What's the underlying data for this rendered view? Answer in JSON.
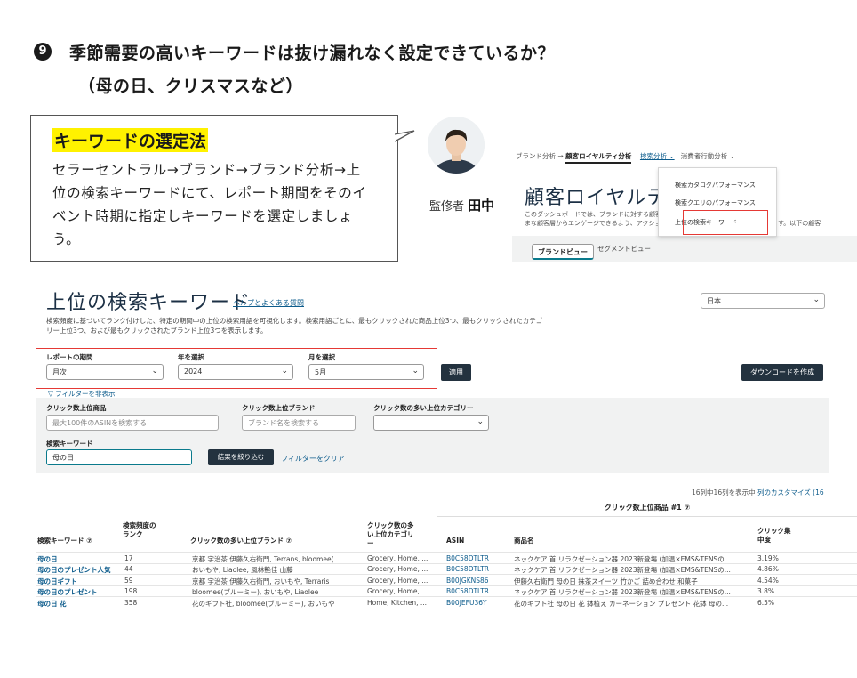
{
  "heading": {
    "number": "9",
    "line1": "季節需要の高いキーワードは抜け漏れなく設定できているか？",
    "line2": "（母の日、クリスマスなど）"
  },
  "callout": {
    "title": "キーワードの選定法",
    "body": "セラーセントラル→ブランド→ブランド分析→上位の検索キーワードにて、レポート期間をそのイベント時期に指定しキーワードを選定しましょう。"
  },
  "supervisor": {
    "prefix": "監修者",
    "name": "田中"
  },
  "mini": {
    "crumb_1": "ブランド分析",
    "crumb_arrow": "→",
    "crumb_2": "顧客ロイヤルティ分析",
    "crumb_3": "検索分析 ⌄",
    "crumb_4": "消費者行動分析 ⌄",
    "menu": [
      "検索カタログパフォーマンス",
      "検索クエリのパフォーマンス",
      "上位の検索キーワード"
    ],
    "title": "顧客ロイヤルティ",
    "desc": "このダッシュボードでは、ブランドに対する顧客のロイヤルティを理解し、さまざまな顧客層からエンゲージできるよう、アクションを",
    "desc_right": "ます。以下の顧客",
    "tabs": [
      "ブランドビュー",
      "セグメントビュー"
    ]
  },
  "report": {
    "title": "上位の検索キーワード",
    "help_link": "ヘルプとよくある質問",
    "desc": "検索頻度に基づいてランク付けした、特定の期間中の上位の検索用語を可視化します。検索用語ごとに、最もクリックされた商品上位3つ、最もクリックされたカテゴリー上位3つ、および最もクリックされたブランド上位3つを表示します。",
    "country": "日本",
    "period_label": "レポートの期間",
    "period_value": "月次",
    "year_label": "年を選択",
    "year_value": "2024",
    "month_label": "月を選択",
    "month_value": "5月",
    "apply": "適用",
    "download": "ダウンロードを作成",
    "filter_toggle": "▽ フィルターを非表示",
    "f_item_label": "クリック数上位商品",
    "f_item_ph": "最大100件のASINを検索する",
    "f_brand_label": "クリック数上位ブランド",
    "f_brand_ph": "ブランド名を検索する",
    "f_cat_label": "クリック数の多い上位カテゴリー",
    "f_kw_label": "検索キーワード",
    "f_kw_value": "母の日",
    "narrow_btn": "結果を絞り込む",
    "clear_link": "フィルターをクリア",
    "colcount_text": "16列中16列を表示中",
    "colcount_link": "列のカスタマイズ (16"
  },
  "table": {
    "group_header": "クリック数上位商品 #1 ⑦",
    "headers": {
      "keyword": "検索キーワード ⑦",
      "rank": "検索頻度のランク",
      "brand": "クリック数の多い上位ブランド ⑦",
      "category": "クリック数の多い上位カテゴリー",
      "asin": "ASIN",
      "product": "商品名",
      "share": "クリック集中度"
    },
    "rows": [
      {
        "keyword": "母の日",
        "rank": "17",
        "brand": "京都 宇治茶 伊藤久右衛門, Terrans, bloomee(...",
        "category": "Grocery, Home, ...",
        "asin": "B0C58DTLTR",
        "product": "ネックケア 首 リラクゼーション器 2023新登場 (加温×EMS&TENSの...",
        "share": "3.19%"
      },
      {
        "keyword": "母の日のプレゼント人気",
        "rank": "44",
        "brand": "おいもや, Liaolee, 風林艶佳 山藤",
        "category": "Grocery, Home, ...",
        "asin": "B0C58DTLTR",
        "product": "ネックケア 首 リラクゼーション器 2023新登場 (加温×EMS&TENSの...",
        "share": "4.86%"
      },
      {
        "keyword": "母の日ギフト",
        "rank": "59",
        "brand": "京都 宇治茶 伊藤久右衛門, おいもや, Terraris",
        "category": "Grocery, Home, ...",
        "asin": "B00JGKNS86",
        "product": "伊藤久右衛門 母の日 抹茶スイーツ 竹かご 詰め合わせ 和菓子",
        "share": "4.54%"
      },
      {
        "keyword": "母の日のプレゼント",
        "rank": "198",
        "brand": "bloomee(ブルーミー), おいもや, Liaolee",
        "category": "Grocery, Home, ...",
        "asin": "B0C58DTLTR",
        "product": "ネックケア 首 リラクゼーション器 2023新登場 (加温×EMS&TENSの...",
        "share": "3.8%"
      },
      {
        "keyword": "母の日 花",
        "rank": "358",
        "brand": "花のギフト社, bloomee(ブルーミー), おいもや",
        "category": "Home, Kitchen, ...",
        "asin": "B00JEFU36Y",
        "product": "花のギフト社 母の日 花 鉢植え カーネーション プレゼント 花鉢 母の...",
        "share": "6.5%"
      }
    ]
  },
  "colors": {
    "accent_red": "#e53935",
    "highlight_yellow": "#fff200",
    "link_blue": "#0d5c8c",
    "dark_button": "#23323f"
  }
}
